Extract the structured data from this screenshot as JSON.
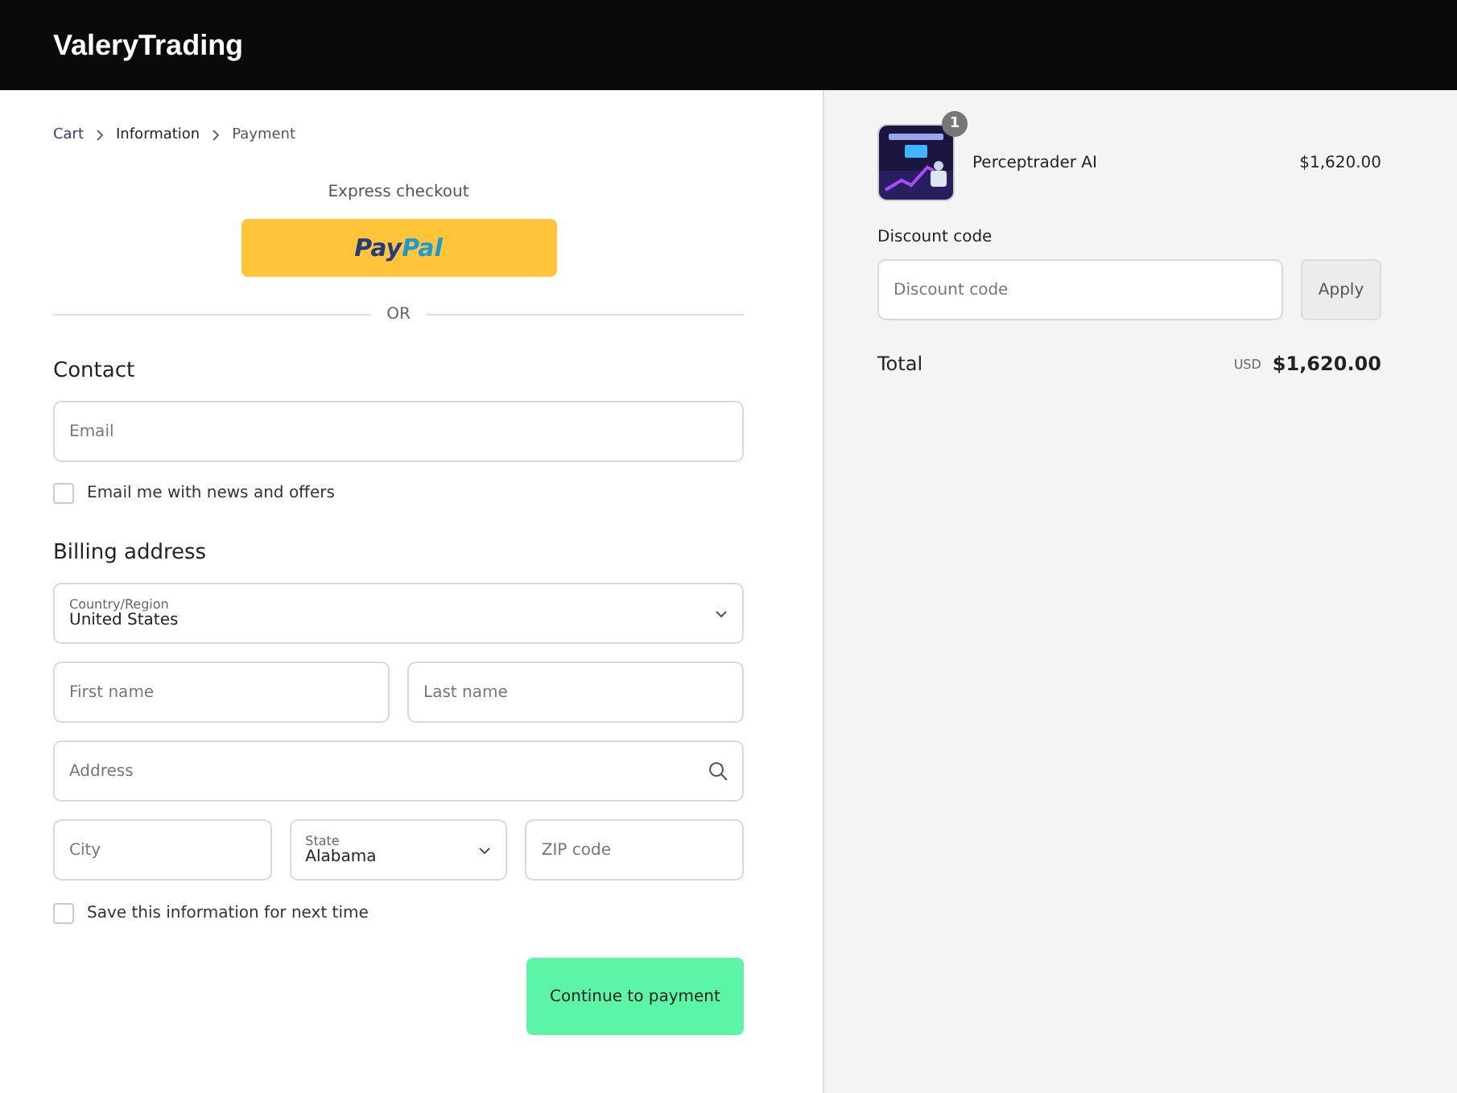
{
  "store": {
    "name": "ValeryTrading"
  },
  "breadcrumbs": [
    {
      "label": "Cart",
      "selected": false
    },
    {
      "label": "Information",
      "selected": true
    },
    {
      "label": "Payment",
      "selected": false
    }
  ],
  "express": {
    "title": "Express checkout",
    "paypal_first": "Pay",
    "paypal_second": "Pal"
  },
  "separator": "OR",
  "contact": {
    "heading": "Contact",
    "email": {
      "placeholder": "Email"
    },
    "newsletter": {
      "label": "Email me with news and offers",
      "checked": false
    }
  },
  "billing": {
    "heading": "Billing address",
    "rows": [
      [
        {
          "kind": "select",
          "label": "Country/Region",
          "value": "United States"
        }
      ],
      [
        {
          "kind": "input",
          "placeholder": "First name"
        },
        {
          "kind": "input",
          "placeholder": "Last name"
        }
      ],
      [
        {
          "kind": "search",
          "placeholder": "Address"
        }
      ],
      [
        {
          "kind": "input",
          "placeholder": "City"
        },
        {
          "kind": "select",
          "label": "State",
          "value": "Alabama"
        },
        {
          "kind": "input",
          "placeholder": "ZIP code"
        }
      ]
    ],
    "save": {
      "label": "Save this information for next time",
      "checked": false
    }
  },
  "continue_button": "Continue to payment",
  "summary": {
    "items": [
      {
        "kind": "picture",
        "name": "Perceptrader AI",
        "price": "$1,620.00",
        "quantity": "1"
      }
    ],
    "discount": {
      "label": "Discount code",
      "placeholder": "Discount code",
      "button": "Apply"
    },
    "total": {
      "label": "Total",
      "currency": "USD",
      "amount": "$1,620.00"
    }
  }
}
